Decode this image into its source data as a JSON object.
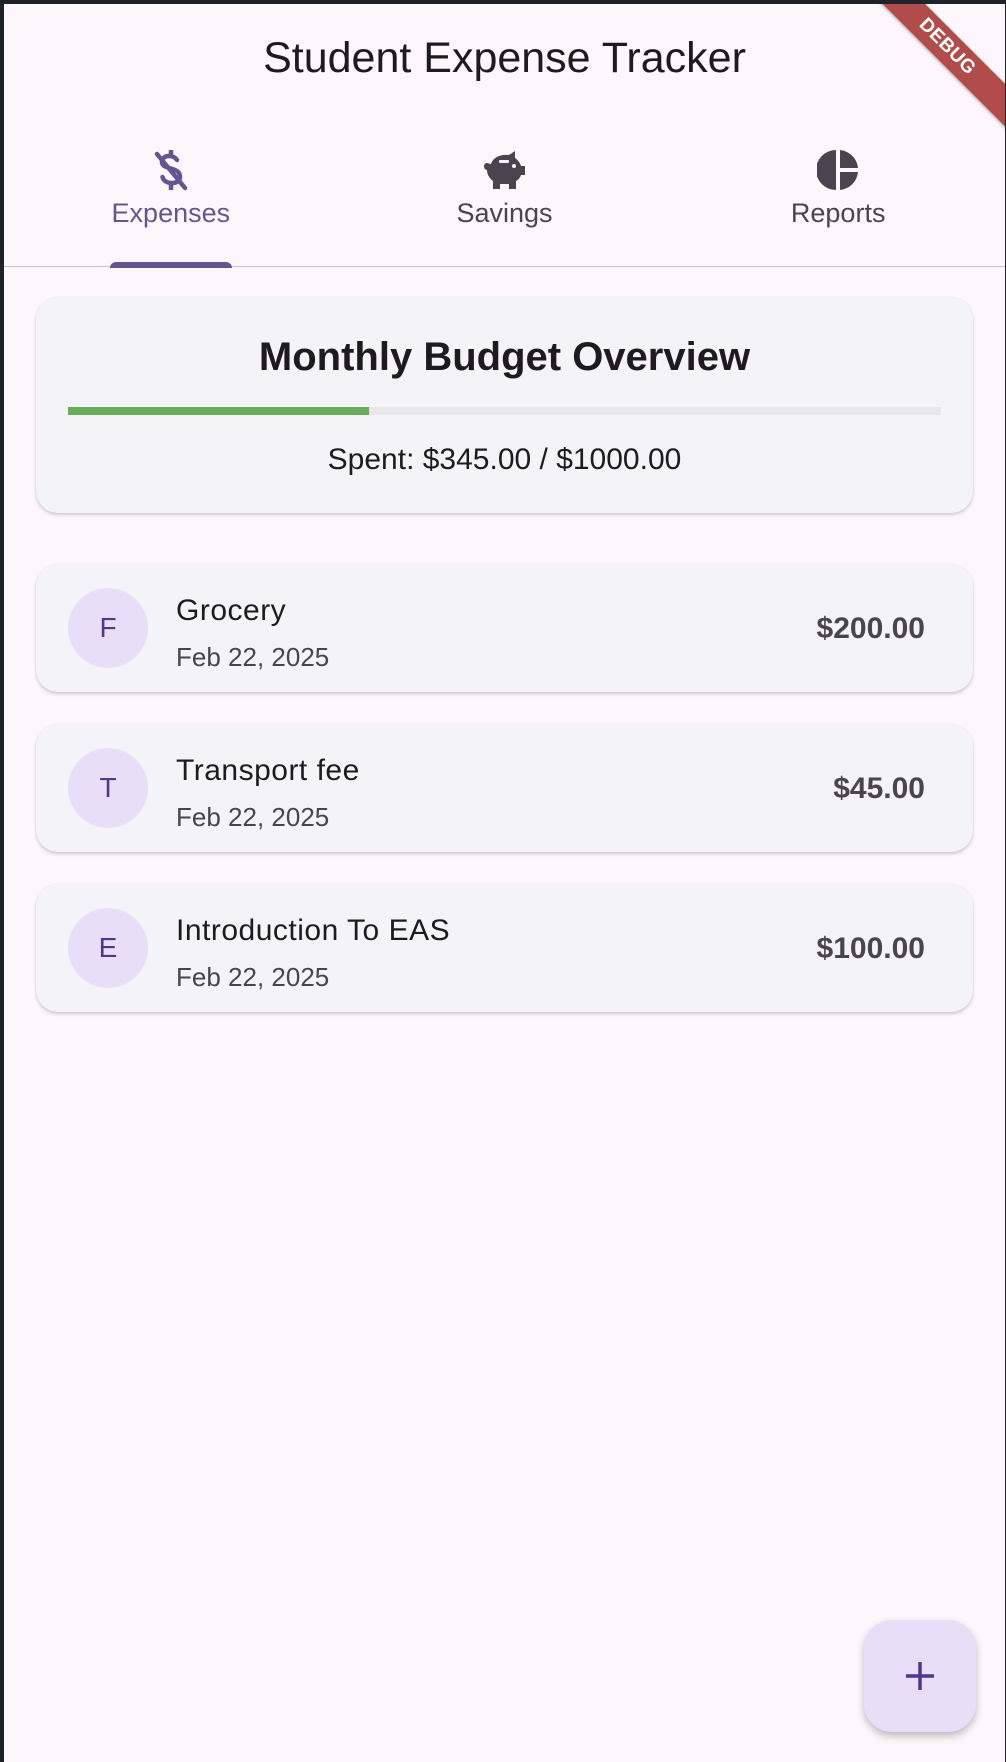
{
  "app": {
    "title": "Student Expense Tracker",
    "debug_banner": "DEBUG"
  },
  "tabs": [
    {
      "label": "Expenses",
      "icon": "money-off-icon",
      "active": true
    },
    {
      "label": "Savings",
      "icon": "piggy-bank-icon",
      "active": false
    },
    {
      "label": "Reports",
      "icon": "pie-chart-icon",
      "active": false
    }
  ],
  "budget": {
    "title": "Monthly Budget Overview",
    "spent_text": "Spent: $345.00 / $1000.00",
    "progress_fraction": 0.345,
    "progress_color": "#67ad5b"
  },
  "expenses": [
    {
      "initial": "F",
      "name": "Grocery",
      "date": "Feb 22, 2025",
      "amount": "$200.00"
    },
    {
      "initial": "T",
      "name": "Transport fee",
      "date": "Feb 22, 2025",
      "amount": "$45.00"
    },
    {
      "initial": "E",
      "name": "Introduction To EAS",
      "date": "Feb 22, 2025",
      "amount": "$100.00"
    }
  ],
  "fab": {
    "icon": "plus-icon"
  },
  "colors": {
    "accent": "#65558f",
    "background": "#fdf7fb",
    "card": "#f4f3f7",
    "avatar_bg": "#e8def8"
  }
}
